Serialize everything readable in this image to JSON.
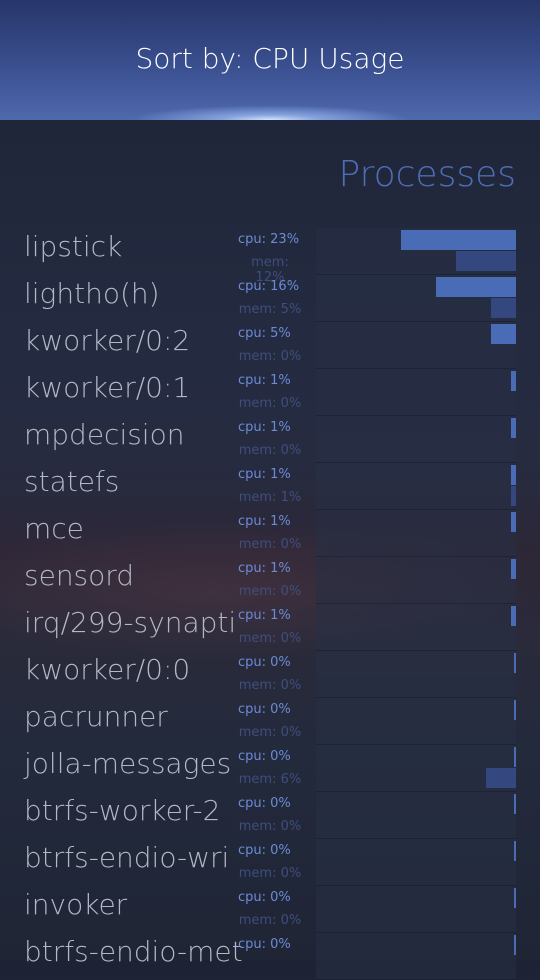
{
  "header": {
    "title": "Sort by: CPU Usage"
  },
  "section_title": "Processes",
  "processes": [
    {
      "name": "lipstick",
      "cpu": "cpu: 23%",
      "mem": "mem: 12%",
      "cpu_pct": 23,
      "mem_pct": 12
    },
    {
      "name": "lightho(h)",
      "cpu": "cpu: 16%",
      "mem": "mem: 5%",
      "cpu_pct": 16,
      "mem_pct": 5
    },
    {
      "name": "kworker/0:2",
      "cpu": "cpu: 5%",
      "mem": "mem: 0%",
      "cpu_pct": 5,
      "mem_pct": 0
    },
    {
      "name": "kworker/0:1",
      "cpu": "cpu: 1%",
      "mem": "mem: 0%",
      "cpu_pct": 1,
      "mem_pct": 0
    },
    {
      "name": "mpdecision",
      "cpu": "cpu: 1%",
      "mem": "mem: 0%",
      "cpu_pct": 1,
      "mem_pct": 0
    },
    {
      "name": "statefs",
      "cpu": "cpu: 1%",
      "mem": "mem: 1%",
      "cpu_pct": 1,
      "mem_pct": 1
    },
    {
      "name": "mce",
      "cpu": "cpu: 1%",
      "mem": "mem: 0%",
      "cpu_pct": 1,
      "mem_pct": 0
    },
    {
      "name": "sensord",
      "cpu": "cpu: 1%",
      "mem": "mem: 0%",
      "cpu_pct": 1,
      "mem_pct": 0
    },
    {
      "name": "irq/299-synapti",
      "cpu": "cpu: 1%",
      "mem": "mem: 0%",
      "cpu_pct": 1,
      "mem_pct": 0
    },
    {
      "name": "kworker/0:0",
      "cpu": "cpu: 0%",
      "mem": "mem: 0%",
      "cpu_pct": 0,
      "mem_pct": 0
    },
    {
      "name": "pacrunner",
      "cpu": "cpu: 0%",
      "mem": "mem: 0%",
      "cpu_pct": 0,
      "mem_pct": 0
    },
    {
      "name": "jolla-messages",
      "cpu": "cpu: 0%",
      "mem": "mem: 6%",
      "cpu_pct": 0,
      "mem_pct": 6
    },
    {
      "name": "btrfs-worker-2",
      "cpu": "cpu: 0%",
      "mem": "mem: 0%",
      "cpu_pct": 0,
      "mem_pct": 0
    },
    {
      "name": "btrfs-endio-wri",
      "cpu": "cpu: 0%",
      "mem": "mem: 0%",
      "cpu_pct": 0,
      "mem_pct": 0
    },
    {
      "name": "invoker",
      "cpu": "cpu: 0%",
      "mem": "mem: 0%",
      "cpu_pct": 0,
      "mem_pct": 0
    },
    {
      "name": "btrfs-endio-met",
      "cpu": "cpu: 0%",
      "mem": "",
      "cpu_pct": 0,
      "mem_pct": 0
    }
  ],
  "colors": {
    "header_bg": "#3a4f8f",
    "accent": "#4e6db6",
    "cpu_bar": "#4a6bb5",
    "mem_bar": "#34487f"
  }
}
